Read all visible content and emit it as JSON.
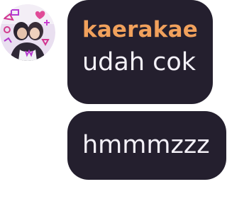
{
  "chat": {
    "messages": [
      {
        "sender": "kaerakae",
        "text": "udah cok"
      },
      {
        "text": "hmmmzzz"
      }
    ]
  },
  "avatar": {
    "icon": "profile-photo-icon"
  },
  "colors": {
    "bubble": "#241f2e",
    "sender": "#f1a15c",
    "text": "#f4f1f8"
  }
}
